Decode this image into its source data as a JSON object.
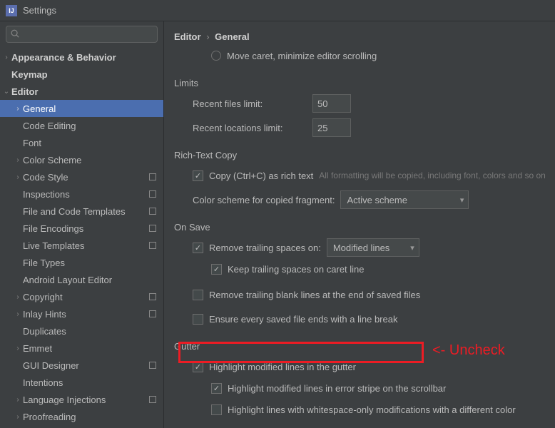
{
  "window": {
    "title": "Settings"
  },
  "search": {
    "placeholder": ""
  },
  "sidebar": {
    "items": [
      {
        "label": "Appearance & Behavior",
        "depth": 0,
        "chevron": "right",
        "bold": true
      },
      {
        "label": "Keymap",
        "depth": 0,
        "chevron": "",
        "bold": true
      },
      {
        "label": "Editor",
        "depth": 0,
        "chevron": "down",
        "bold": true
      },
      {
        "label": "General",
        "depth": 1,
        "chevron": "right",
        "bold": false,
        "selected": true
      },
      {
        "label": "Code Editing",
        "depth": 1,
        "chevron": "",
        "bold": false
      },
      {
        "label": "Font",
        "depth": 1,
        "chevron": "",
        "bold": false
      },
      {
        "label": "Color Scheme",
        "depth": 1,
        "chevron": "right",
        "bold": false
      },
      {
        "label": "Code Style",
        "depth": 1,
        "chevron": "right",
        "bold": false,
        "marker": true
      },
      {
        "label": "Inspections",
        "depth": 1,
        "chevron": "",
        "bold": false,
        "marker": true
      },
      {
        "label": "File and Code Templates",
        "depth": 1,
        "chevron": "",
        "bold": false,
        "marker": true
      },
      {
        "label": "File Encodings",
        "depth": 1,
        "chevron": "",
        "bold": false,
        "marker": true
      },
      {
        "label": "Live Templates",
        "depth": 1,
        "chevron": "",
        "bold": false,
        "marker": true
      },
      {
        "label": "File Types",
        "depth": 1,
        "chevron": "",
        "bold": false
      },
      {
        "label": "Android Layout Editor",
        "depth": 1,
        "chevron": "",
        "bold": false
      },
      {
        "label": "Copyright",
        "depth": 1,
        "chevron": "right",
        "bold": false,
        "marker": true
      },
      {
        "label": "Inlay Hints",
        "depth": 1,
        "chevron": "right",
        "bold": false,
        "marker": true
      },
      {
        "label": "Duplicates",
        "depth": 1,
        "chevron": "",
        "bold": false
      },
      {
        "label": "Emmet",
        "depth": 1,
        "chevron": "right",
        "bold": false
      },
      {
        "label": "GUI Designer",
        "depth": 1,
        "chevron": "",
        "bold": false,
        "marker": true
      },
      {
        "label": "Intentions",
        "depth": 1,
        "chevron": "",
        "bold": false
      },
      {
        "label": "Language Injections",
        "depth": 1,
        "chevron": "right",
        "bold": false,
        "marker": true
      },
      {
        "label": "Proofreading",
        "depth": 1,
        "chevron": "right",
        "bold": false
      }
    ]
  },
  "breadcrumb": {
    "a": "Editor",
    "b": "General"
  },
  "radio": {
    "move_caret": "Move caret, minimize editor scrolling"
  },
  "limits": {
    "title": "Limits",
    "recent_files_label": "Recent files limit:",
    "recent_files_value": "50",
    "recent_locations_label": "Recent locations limit:",
    "recent_locations_value": "25"
  },
  "richtext": {
    "title": "Rich-Text Copy",
    "copy_label": "Copy (Ctrl+C) as rich text",
    "copy_hint": "All formatting will be copied, including font, colors and so on",
    "scheme_label": "Color scheme for copied fragment:",
    "scheme_value": "Active scheme"
  },
  "onsave": {
    "title": "On Save",
    "remove_trailing_label": "Remove trailing spaces on:",
    "remove_trailing_value": "Modified lines",
    "keep_caret_label": "Keep trailing spaces on caret line",
    "remove_blank_label": "Remove trailing blank lines at the end of saved files",
    "ensure_newline_label": "Ensure every saved file ends with a line break"
  },
  "gutter": {
    "title": "Gutter",
    "highlight_modified_label": "Highlight modified lines in the gutter",
    "highlight_stripe_label": "Highlight modified lines in error stripe on the scrollbar",
    "highlight_whitespace_label": "Highlight lines with whitespace-only modifications with a different color"
  },
  "annotation": {
    "text": "<- Uncheck"
  }
}
